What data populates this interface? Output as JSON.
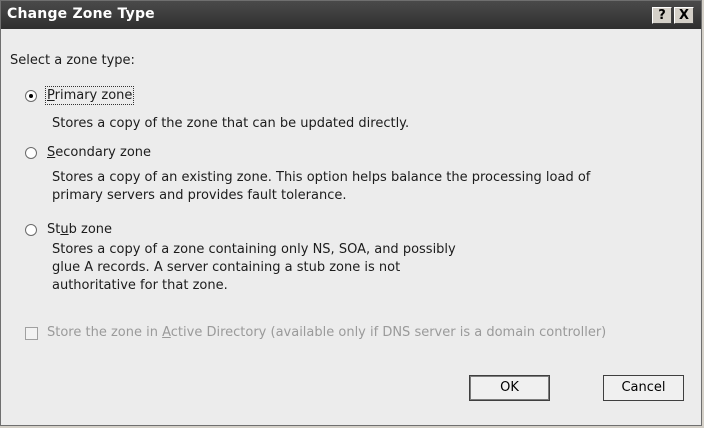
{
  "dialog": {
    "title": "Change Zone Type",
    "help_button": "?",
    "close_button": "X"
  },
  "prompt": "Select a zone type:",
  "options": [
    {
      "label_pre": "",
      "label_key": "P",
      "label_post": "rimary zone",
      "selected": true,
      "description": [
        "Stores a copy of the zone that can be updated directly."
      ]
    },
    {
      "label_pre": "",
      "label_key": "S",
      "label_post": "econdary zone",
      "selected": false,
      "description": [
        "Stores a copy of an existing zone. This option helps balance the processing load of",
        "primary servers and provides fault tolerance."
      ]
    },
    {
      "label_pre": "St",
      "label_key": "u",
      "label_post": "b zone",
      "selected": false,
      "description": [
        "Stores a copy of a zone containing only NS, SOA, and possibly",
        "glue A records. A server containing a stub zone is not",
        "authoritative for that zone."
      ]
    }
  ],
  "ad_checkbox": {
    "label_pre": "Store the zone in ",
    "label_key": "A",
    "label_post": "ctive Directory (available only if DNS server is a domain controller)",
    "checked": false,
    "enabled": false
  },
  "buttons": {
    "ok": "OK",
    "cancel": "Cancel"
  }
}
